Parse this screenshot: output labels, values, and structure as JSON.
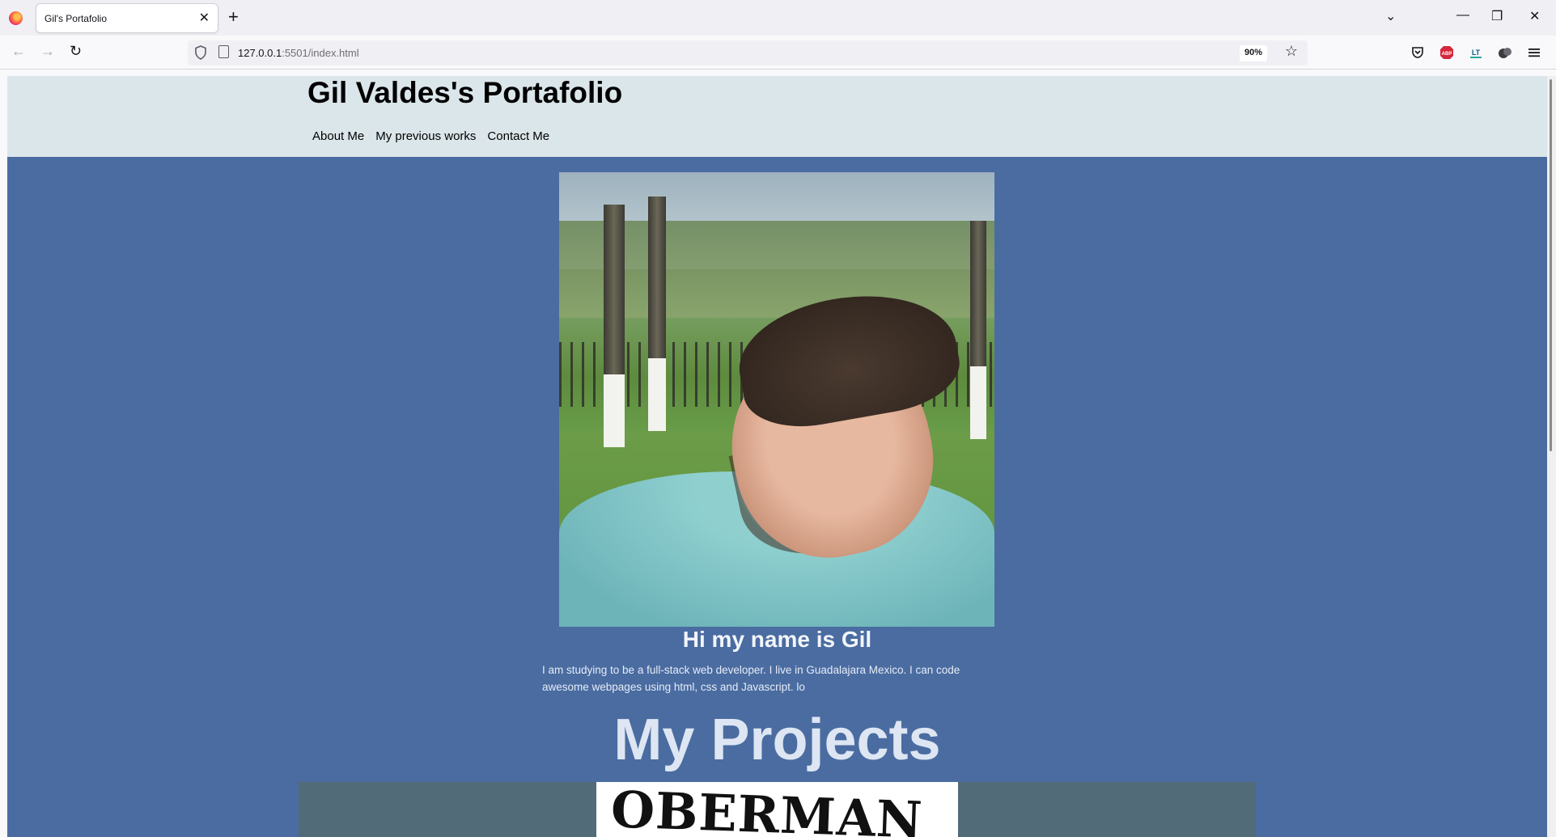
{
  "browser": {
    "tab_title": "Gil's Portafolio",
    "url_host": "127.0.0.1",
    "url_path": ":5501/index.html",
    "zoom": "90%",
    "icons": [
      "firefox-logo",
      "back-icon",
      "forward-icon",
      "reload-icon",
      "shield-icon",
      "page-icon",
      "star-icon",
      "pocket-icon",
      "adblock-icon",
      "extension-icon",
      "account-icon",
      "menu-icon"
    ]
  },
  "site": {
    "title": "Gil Valdes's Portafolio",
    "nav": [
      "About Me",
      "My previous works",
      "Contact Me"
    ]
  },
  "hero": {
    "greeting": "Hi my name is Gil",
    "bio": "I am studying to be a full-stack web developer. I live in Guadalajara Mexico. I can code awesome webpages using html, css and Javascript. lo"
  },
  "projects": {
    "heading": "My Projects",
    "first_project_image_text": "OBERMAN"
  },
  "colors": {
    "header_bg": "#dbe6ea",
    "page_bg": "#4a6ca1",
    "project_card_bg": "#516b78"
  }
}
